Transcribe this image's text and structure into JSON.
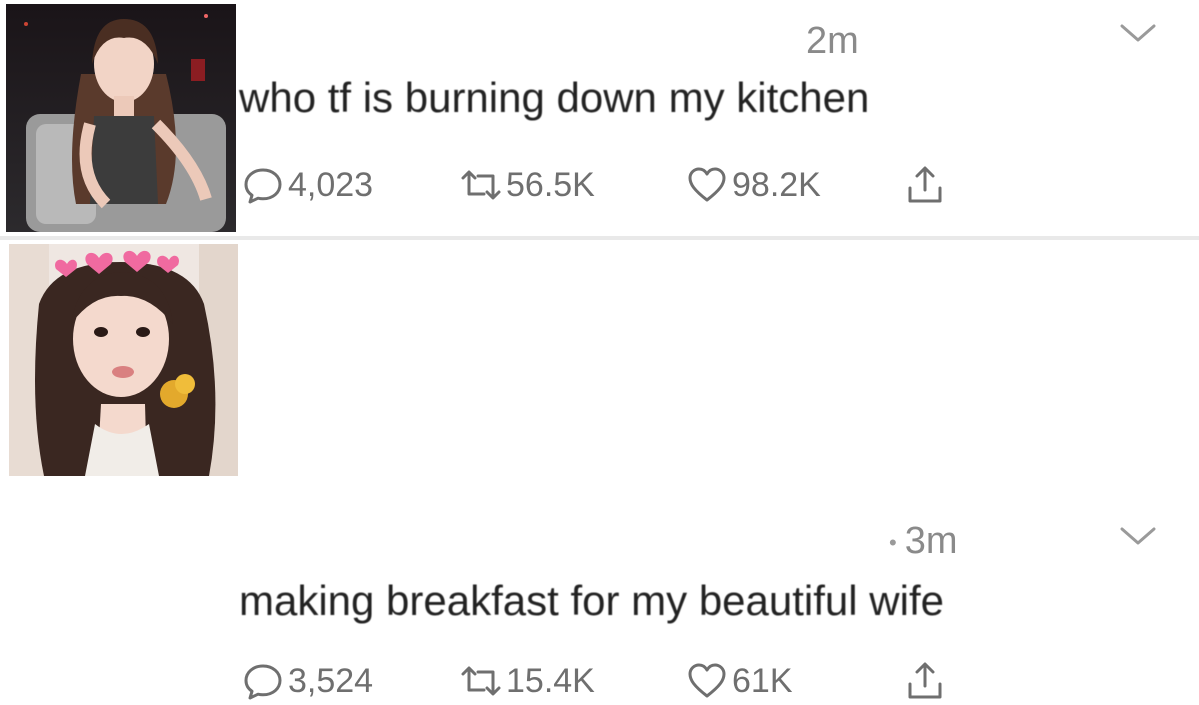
{
  "tweets": [
    {
      "time": "2m",
      "text": "who tf is burning down my kitchen",
      "replies": "4,023",
      "retweets": "56.5K",
      "likes": "98.2K"
    },
    {
      "time": "3m",
      "time_prefix": "•",
      "text": "making breakfast for my beautiful wife",
      "replies": "3,524",
      "retweets": "15.4K",
      "likes": "61K"
    }
  ],
  "icons": {
    "reply": "reply-bubble-icon",
    "retweet": "retweet-icon",
    "like": "heart-icon",
    "share": "share-icon",
    "menu": "chevron-down-icon"
  },
  "colors": {
    "text": "#222222",
    "muted": "#8a8a8a",
    "icon": "#6f6f6f",
    "divider": "#e9e9e9"
  }
}
